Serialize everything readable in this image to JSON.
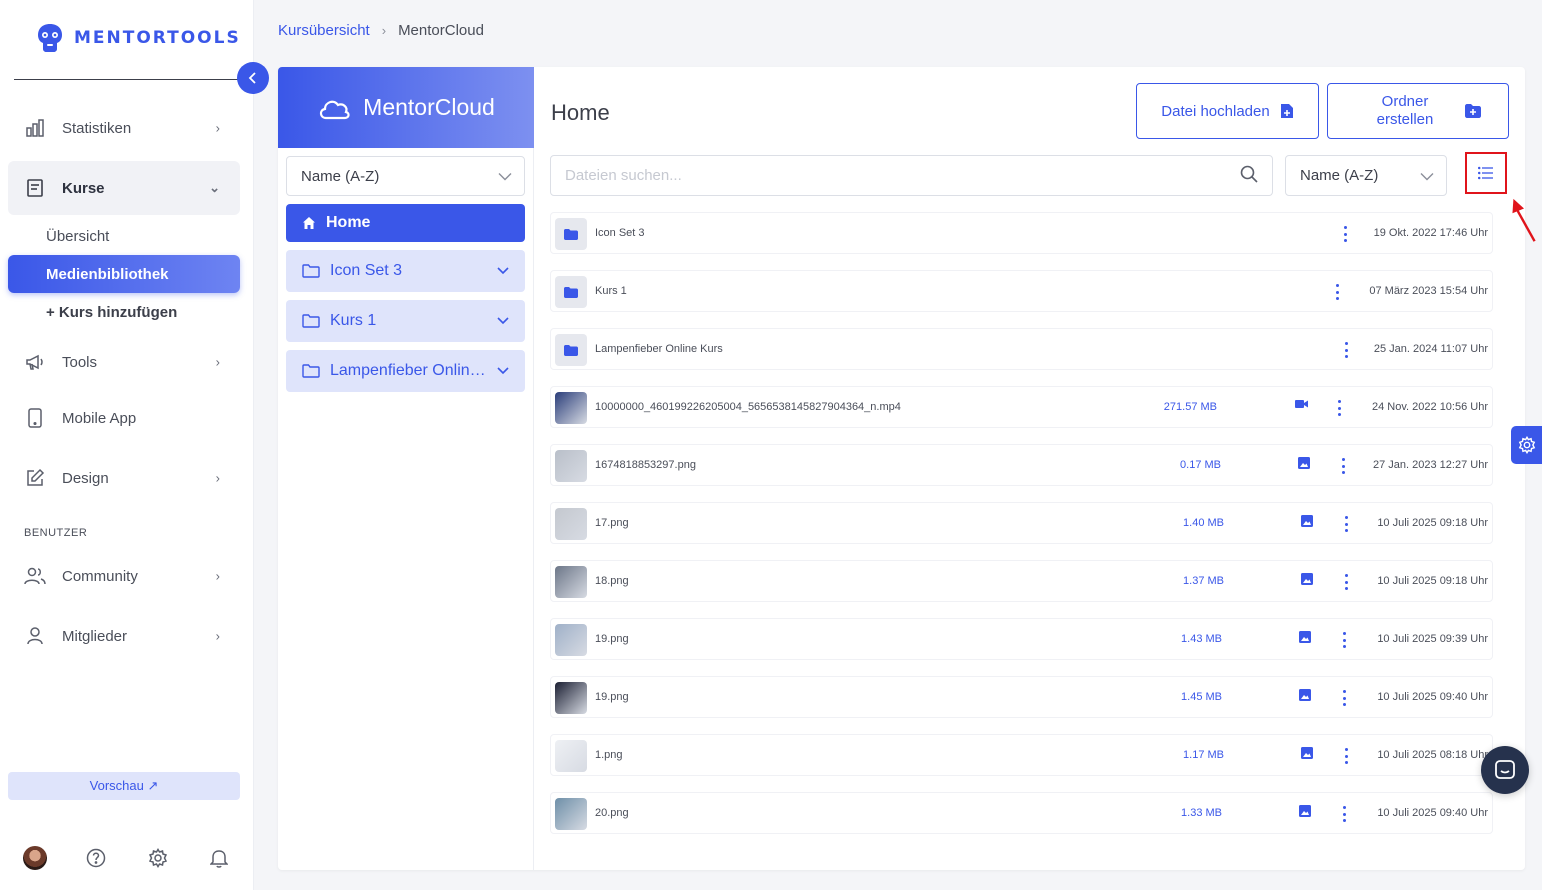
{
  "brand": {
    "name": "MENTORTOOLS",
    "accent": "#3a57e8"
  },
  "sidebar": {
    "items": [
      {
        "label": "Statistiken",
        "icon": "bar-chart-icon"
      },
      {
        "label": "Kurse",
        "icon": "book-icon"
      },
      {
        "label": "Tools",
        "icon": "megaphone-icon"
      },
      {
        "label": "Mobile App",
        "icon": "phone-icon"
      },
      {
        "label": "Design",
        "icon": "edit-icon"
      },
      {
        "label": "Community",
        "icon": "users-icon"
      },
      {
        "label": "Mitglieder",
        "icon": "user-icon"
      }
    ],
    "sub_items": [
      "Übersicht",
      "Medienbibliothek",
      "+ Kurs hinzufügen"
    ],
    "section_label": "BENUTZER",
    "preview": "Vorschau ↗"
  },
  "breadcrumb": {
    "parent": "Kursübersicht",
    "separator": "›",
    "current": "MentorCloud"
  },
  "cloud": {
    "title": "MentorCloud",
    "sort": "Name (A-Z)",
    "folders": [
      {
        "label": "Home"
      },
      {
        "label": "Icon Set 3"
      },
      {
        "label": "Kurs 1"
      },
      {
        "label": "Lampenfieber Online Kurs"
      }
    ]
  },
  "main": {
    "title": "Home",
    "upload_label": "Datei hochladen",
    "create_folder_label": "Ordner erstellen",
    "search_placeholder": "Dateien suchen...",
    "sort": "Name (A-Z)"
  },
  "files": [
    {
      "name": "Icon Set 3",
      "size": "",
      "type": "folder",
      "date": "19 Okt. 2022 17:46 Uhr"
    },
    {
      "name": "Kurs 1",
      "size": "",
      "type": "folder",
      "date": "07 März 2023 15:54 Uhr"
    },
    {
      "name": "Lampenfieber Online Kurs",
      "size": "",
      "type": "folder",
      "date": "25 Jan. 2024 11:07 Uhr"
    },
    {
      "name": "10000000_460199226205004_5656538145827904364_n.mp4",
      "size": "271.57 MB",
      "type": "video",
      "date": "24 Nov. 2022 10:56 Uhr"
    },
    {
      "name": "1674818853297.png",
      "size": "0.17 MB",
      "type": "image",
      "date": "27 Jan. 2023 12:27 Uhr"
    },
    {
      "name": "17.png",
      "size": "1.40 MB",
      "type": "image",
      "date": "10 Juli 2025 09:18 Uhr"
    },
    {
      "name": "18.png",
      "size": "1.37 MB",
      "type": "image",
      "date": "10 Juli 2025 09:18 Uhr"
    },
    {
      "name": "19.png",
      "size": "1.43 MB",
      "type": "image",
      "date": "10 Juli 2025 09:39 Uhr"
    },
    {
      "name": "19.png",
      "size": "1.45 MB",
      "type": "image",
      "date": "10 Juli 2025 09:40 Uhr"
    },
    {
      "name": "1.png",
      "size": "1.17 MB",
      "type": "image",
      "date": "10 Juli 2025 08:18 Uhr"
    },
    {
      "name": "20.png",
      "size": "1.33 MB",
      "type": "image",
      "date": "10 Juli 2025 09:40 Uhr"
    }
  ]
}
